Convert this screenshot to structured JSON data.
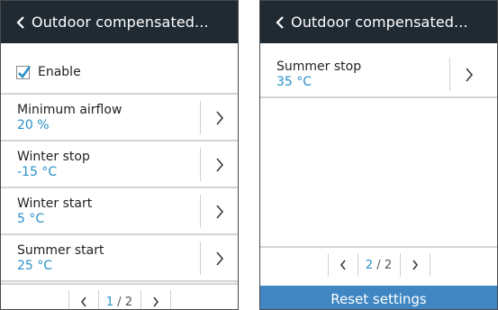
{
  "screens": [
    {
      "header": {
        "title": "Outdoor compensated..."
      },
      "enable": {
        "label": "Enable",
        "checked": true
      },
      "items": [
        {
          "label": "Minimum airflow",
          "value": "20 %"
        },
        {
          "label": "Winter stop",
          "value": "-15 °C"
        },
        {
          "label": "Winter start",
          "value": "5 °C"
        },
        {
          "label": "Summer start",
          "value": "25 °C"
        }
      ],
      "pager": {
        "current": "1",
        "separator": "/",
        "total": "2"
      }
    },
    {
      "header": {
        "title": "Outdoor compensated..."
      },
      "items": [
        {
          "label": "Summer stop",
          "value": "35 °C"
        }
      ],
      "pager": {
        "current": "2",
        "separator": "/",
        "total": "2"
      },
      "reset_label": "Reset settings"
    }
  ],
  "colors": {
    "header_bg": "#1f2a33",
    "value_text": "#2a8fc8",
    "reset_button": "#3f86c3",
    "checkbox_check": "#2a8fc8"
  },
  "icons": {
    "back": "chevron-left-icon",
    "item_action": "chevron-right-icon",
    "check": "checkmark-icon"
  }
}
